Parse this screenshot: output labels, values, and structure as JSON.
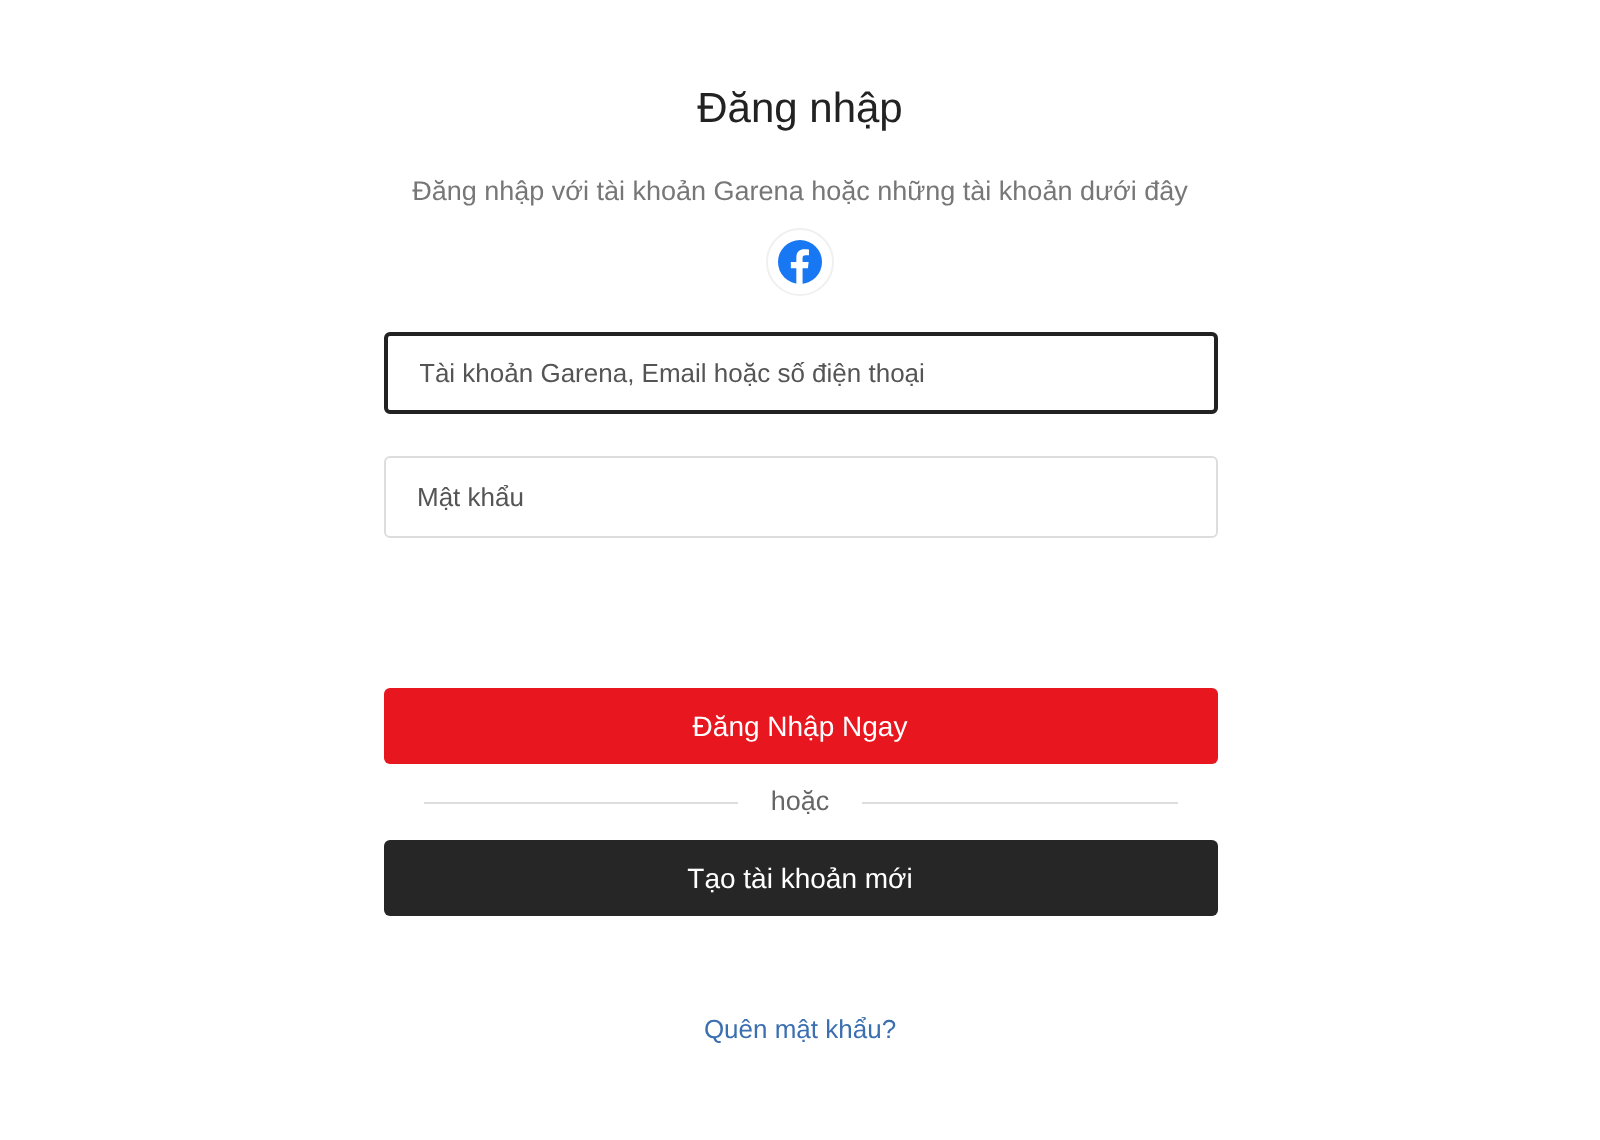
{
  "title": "Đăng nhập",
  "subtitle": "Đăng nhập với tài khoản Garena hoặc những tài khoản dưới đây",
  "fields": [
    {
      "placeholder": "Tài khoản Garena, Email hoặc số điện thoại",
      "focused": true
    },
    {
      "placeholder": "Mật khẩu",
      "focused": false
    }
  ],
  "login_button": "Đăng Nhập Ngay",
  "divider_text": "hoặc",
  "register_button": "Tạo tài khoản mới",
  "forgot_link": "Quên mật khẩu?"
}
